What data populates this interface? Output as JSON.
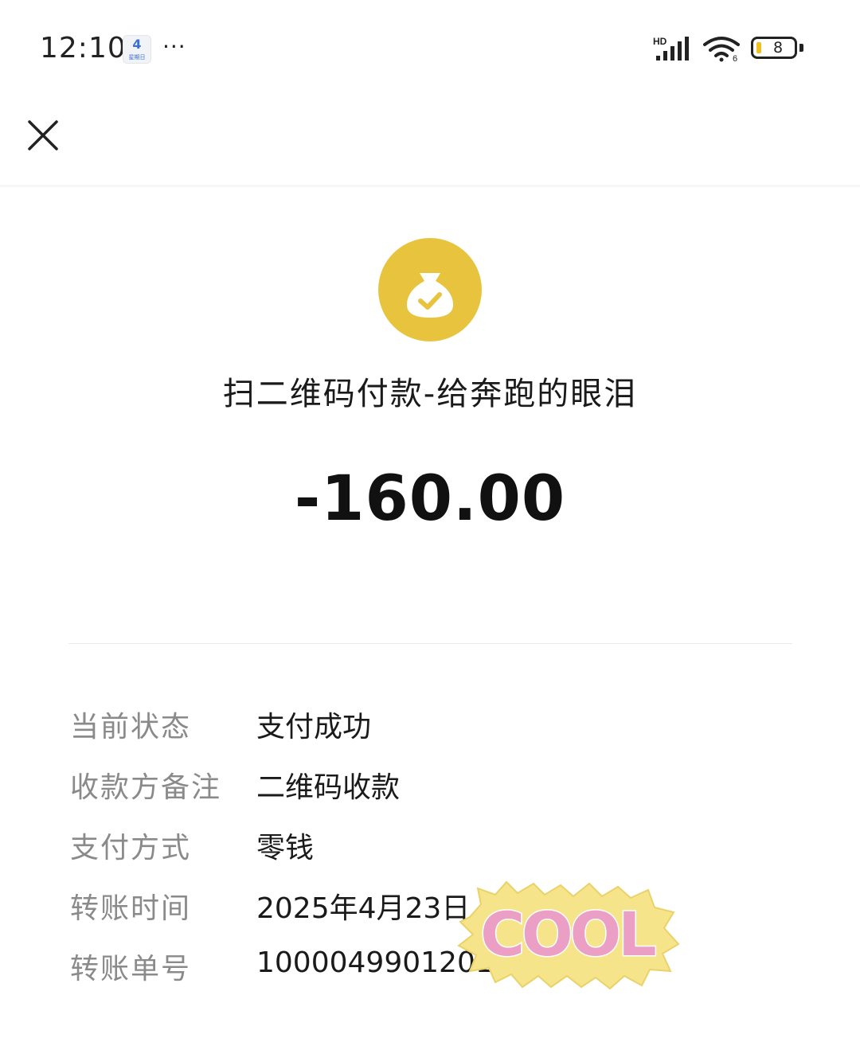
{
  "status_bar": {
    "time": "12:10",
    "calendar_day": "4",
    "calendar_sub": "星期日",
    "more": "···",
    "network": "HD",
    "wifi_sub": "6",
    "battery_percent": "8"
  },
  "detail": {
    "title": "扫二维码付款-给奔跑的眼泪",
    "amount": "-160.00",
    "rows": [
      {
        "label": "当前状态",
        "value": "支付成功"
      },
      {
        "label": "收款方备注",
        "value": "二维码收款"
      },
      {
        "label": "支付方式",
        "value": "零钱"
      },
      {
        "label": "转账时间",
        "value": "2025年4月23日"
      },
      {
        "label": "转账单号",
        "value": "1000049901201919813 5"
      }
    ]
  },
  "sticker": {
    "text": "COOL"
  },
  "colors": {
    "coin_yellow": "#e8c43e",
    "label_gray": "#8a8a8a",
    "battery_low": "#f0c020"
  },
  "icons": [
    "close-icon",
    "money-bag-check-icon",
    "signal-icon",
    "wifi-icon",
    "battery-icon",
    "calendar-icon"
  ]
}
